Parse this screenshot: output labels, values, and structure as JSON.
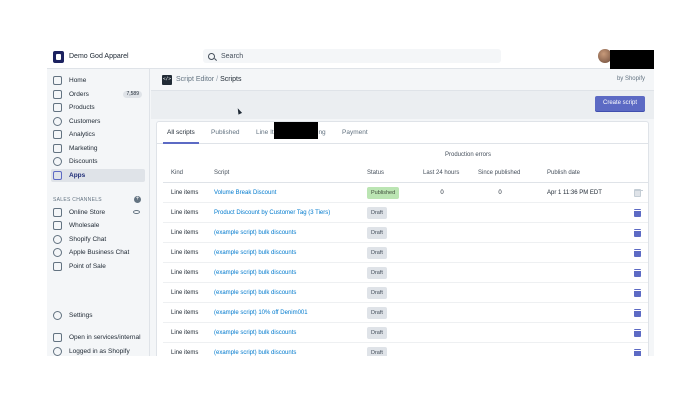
{
  "topbar": {
    "store_name": "Demo God Apparel",
    "search_placeholder": "Search"
  },
  "sidebar": {
    "items": [
      {
        "label": "Home",
        "icon": "home-icon"
      },
      {
        "label": "Orders",
        "icon": "orders-icon",
        "badge": "7,589"
      },
      {
        "label": "Products",
        "icon": "tag-icon"
      },
      {
        "label": "Customers",
        "icon": "person-icon"
      },
      {
        "label": "Analytics",
        "icon": "bar-chart-icon"
      },
      {
        "label": "Marketing",
        "icon": "megaphone-icon"
      },
      {
        "label": "Discounts",
        "icon": "discount-icon"
      },
      {
        "label": "Apps",
        "icon": "apps-icon",
        "active": true
      }
    ],
    "sales_channels_label": "SALES CHANNELS",
    "channels": [
      {
        "label": "Online Store",
        "icon": "store-icon"
      },
      {
        "label": "Wholesale",
        "icon": "wholesale-icon"
      },
      {
        "label": "Shopify Chat",
        "icon": "chat-icon"
      },
      {
        "label": "Apple Business Chat",
        "icon": "apple-chat-icon"
      },
      {
        "label": "Point of Sale",
        "icon": "pos-icon"
      }
    ],
    "settings_label": "Settings",
    "open_in_label": "Open in services/internal",
    "logged_in_label": "Logged in as Shopify"
  },
  "header": {
    "app_name": "Script Editor",
    "separator": "/",
    "page_title": "Scripts",
    "by_label": "by Shopify",
    "create_button": "Create script"
  },
  "tabs": [
    {
      "label": "All scripts",
      "active": true
    },
    {
      "label": "Published"
    },
    {
      "label": "Line It"
    },
    {
      "label": "ing"
    },
    {
      "label": "Payment"
    }
  ],
  "table": {
    "group_header": "Production errors",
    "columns": [
      "Kind",
      "Script",
      "Status",
      "Last 24 hours",
      "Since published",
      "Publish date"
    ],
    "rows": [
      {
        "kind": "Line items",
        "script": "Volume Break Discount",
        "status": "Published",
        "last24": "0",
        "since": "0",
        "date": "Apr 1 11:36 PM EDT"
      },
      {
        "kind": "Line items",
        "script": "Product Discount by Customer Tag (3 Tiers)",
        "status": "Draft",
        "last24": "",
        "since": "",
        "date": ""
      },
      {
        "kind": "Line items",
        "script": "(example script) bulk discounts",
        "status": "Draft",
        "last24": "",
        "since": "",
        "date": ""
      },
      {
        "kind": "Line items",
        "script": "(example script) bulk discounts",
        "status": "Draft",
        "last24": "",
        "since": "",
        "date": ""
      },
      {
        "kind": "Line items",
        "script": "(example script) bulk discounts",
        "status": "Draft",
        "last24": "",
        "since": "",
        "date": ""
      },
      {
        "kind": "Line items",
        "script": "(example script) bulk discounts",
        "status": "Draft",
        "last24": "",
        "since": "",
        "date": ""
      },
      {
        "kind": "Line items",
        "script": "(example script) 10% off Denim001",
        "status": "Draft",
        "last24": "",
        "since": "",
        "date": ""
      },
      {
        "kind": "Line items",
        "script": "(example script) bulk discounts",
        "status": "Draft",
        "last24": "",
        "since": "",
        "date": ""
      },
      {
        "kind": "Line items",
        "script": "(example script) bulk discounts",
        "status": "Draft",
        "last24": "",
        "since": "",
        "date": ""
      }
    ]
  },
  "colors": {
    "accent": "#5c6ac4",
    "link": "#007ace",
    "published": "#bbe5b3",
    "draft": "#dfe3e8"
  }
}
